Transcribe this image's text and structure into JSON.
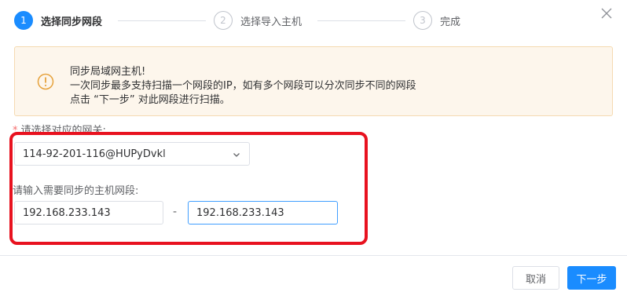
{
  "steps": [
    {
      "number": "1",
      "label": "选择同步网段",
      "state": "active"
    },
    {
      "number": "2",
      "label": "选择导入主机",
      "state": "inactive"
    },
    {
      "number": "3",
      "label": "完成",
      "state": "inactive"
    }
  ],
  "close_icon": "close-icon",
  "alert": {
    "icon": "warning-circle-icon",
    "title": "同步局域网主机!",
    "line1": "一次同步最多支持扫描一个网段的IP，如有多个网段可以分次同步不同的网段",
    "line2": "点击 “下一步” 对此网段进行扫描。"
  },
  "form": {
    "required_mark": "*",
    "gateway_label": "请选择对应的网关:",
    "gateway_value": "114-92-201-116@HUPyDvkl",
    "range_label": "请输入需要同步的主机网段:",
    "ip_start": "192.168.233.143",
    "separator": "-",
    "ip_end": "192.168.233.143"
  },
  "footer": {
    "cancel_label": "取消",
    "next_label": "下一步"
  },
  "colors": {
    "primary": "#1a8cff",
    "warning_bg": "#fdf6ec",
    "warning_icon": "#e6a23c",
    "highlight": "#e8121f"
  }
}
